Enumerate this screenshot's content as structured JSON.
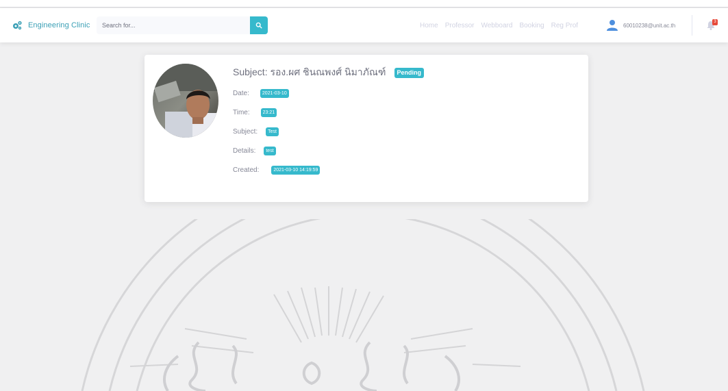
{
  "brand": {
    "name": "Engineering Clinic",
    "icon": "cogs-icon"
  },
  "search": {
    "placeholder": "Search for..."
  },
  "nav": {
    "links": [
      "Home",
      "Professor",
      "Webboard",
      "Booking",
      "Reg Prof"
    ]
  },
  "user": {
    "email": "60010238@unit.ac.th",
    "icon": "user-icon"
  },
  "alerts": {
    "icon": "bell-icon",
    "count": "3"
  },
  "booking": {
    "subject_title": "Subject: รอง.ผศ ชินณพงศ์ นิมาภัณฑ์",
    "status": "Pending",
    "rows": [
      {
        "label": "Date:",
        "value": "2021-03-10"
      },
      {
        "label": "Time:",
        "value": "23:21"
      },
      {
        "label": "Subject:",
        "value": "Test"
      },
      {
        "label": "Details:",
        "value": "test"
      },
      {
        "label": "Created:",
        "value": "2021-03-10 14:19:59"
      }
    ]
  },
  "colors": {
    "accent": "#36b9cc",
    "brand_text": "#3a9fb5",
    "danger": "#e74a3b",
    "background": "#f0f0f1"
  }
}
